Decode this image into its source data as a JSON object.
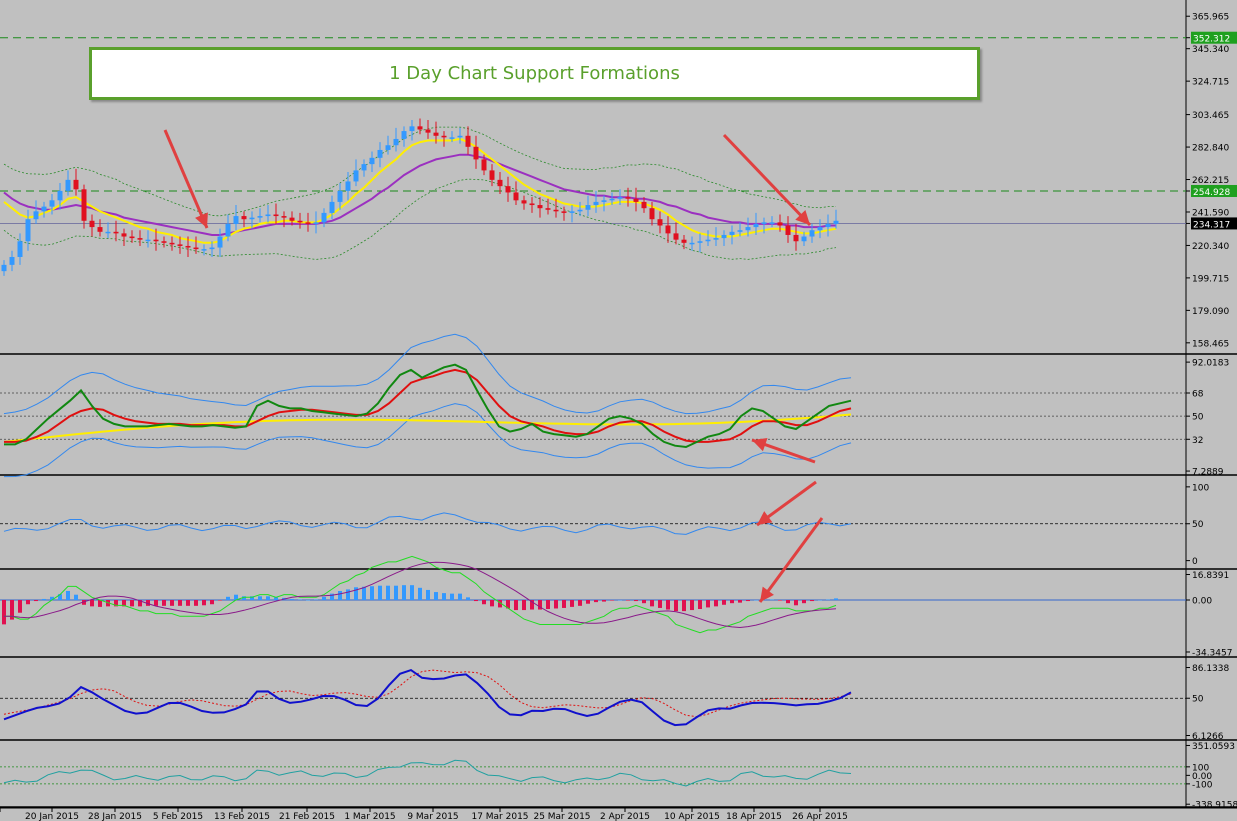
{
  "chart_data": {
    "title": "1 Day Chart Support Formations",
    "type": "candlestick",
    "x_ticks": [
      "2015",
      "20 Jan 2015",
      "28 Jan 2015",
      "5 Feb 2015",
      "13 Feb 2015",
      "21 Feb 2015",
      "1 Mar 2015",
      "9 Mar 2015",
      "17 Mar 2015",
      "25 Mar 2015",
      "2 Apr 2015",
      "10 Apr 2015",
      "18 Apr 2015",
      "26 Apr 2015"
    ],
    "price_panel": {
      "yticks": [
        365.965,
        345.34,
        324.715,
        303.465,
        282.84,
        262.215,
        241.59,
        220.34,
        199.715,
        179.09,
        158.465
      ],
      "ylim": [
        158.465,
        375.0
      ],
      "current_price": 234.317,
      "hlines": [
        {
          "value": 352.312,
          "label": "352.312",
          "color": "#1a8a1a"
        },
        {
          "value": 254.928,
          "label": "254.928",
          "color": "#1a8a1a"
        }
      ],
      "close": [
        208,
        213,
        223,
        237,
        242,
        245,
        249,
        255,
        262,
        256,
        236,
        232,
        229,
        229,
        228,
        226,
        225,
        224,
        224,
        223,
        222,
        221,
        220,
        219,
        218,
        218,
        219,
        226,
        234,
        239,
        237,
        238,
        239,
        240,
        239,
        238,
        236,
        235,
        234,
        235,
        241,
        248,
        255,
        261,
        268,
        272,
        276,
        281,
        284,
        288,
        293,
        296,
        294,
        292,
        290,
        289,
        289,
        290,
        283,
        275,
        268,
        262,
        258,
        254,
        249,
        247,
        246,
        244,
        243,
        242,
        241,
        242,
        243,
        246,
        248,
        249,
        250,
        251,
        250,
        248,
        244,
        237,
        233,
        228,
        224,
        222,
        222,
        223,
        224,
        225,
        227,
        229,
        230,
        232,
        234,
        235,
        235,
        233,
        227,
        223,
        226,
        230,
        232,
        234,
        236
      ],
      "ema_fast": [
        248,
        244,
        240,
        238,
        239,
        241,
        243,
        246,
        250,
        251,
        248,
        245,
        242,
        240,
        238,
        236,
        234,
        232,
        231,
        229,
        228,
        227,
        225,
        224,
        223,
        222,
        222,
        223,
        226,
        229,
        231,
        232,
        234,
        235,
        235,
        236,
        236,
        235,
        235,
        235,
        237,
        240,
        244,
        248,
        253,
        257,
        262,
        267,
        271,
        275,
        280,
        284,
        286,
        287,
        287,
        287,
        287,
        288,
        286,
        283,
        279,
        275,
        271,
        267,
        263,
        259,
        256,
        253,
        251,
        249,
        247,
        246,
        245,
        245,
        245,
        246,
        247,
        248,
        248,
        248,
        247,
        245,
        243,
        240,
        236,
        233,
        230,
        228,
        227,
        226,
        226,
        226,
        227,
        228,
        229,
        230,
        231,
        231,
        230,
        229,
        228,
        228,
        229,
        230,
        231
      ],
      "ema_slow": [
        254,
        250,
        247,
        245,
        244,
        243,
        243,
        244,
        245,
        246,
        245,
        244,
        242,
        241,
        240,
        238,
        237,
        236,
        235,
        234,
        233,
        232,
        231,
        230,
        229,
        228,
        227,
        227,
        228,
        229,
        230,
        231,
        232,
        233,
        234,
        234,
        234,
        234,
        234,
        234,
        235,
        236,
        238,
        241,
        244,
        247,
        250,
        254,
        257,
        261,
        265,
        268,
        271,
        273,
        275,
        276,
        277,
        278,
        278,
        277,
        276,
        274,
        272,
        270,
        268,
        266,
        264,
        262,
        260,
        258,
        256,
        255,
        254,
        253,
        252,
        252,
        251,
        251,
        251,
        250,
        250,
        249,
        248,
        246,
        245,
        243,
        241,
        240,
        238,
        237,
        236,
        235,
        235,
        234,
        234,
        234,
        234,
        234,
        233,
        233,
        232,
        232,
        232,
        233,
        233
      ]
    },
    "rsi_panel": {
      "yticks": [
        92.0183,
        68,
        50,
        32,
        7.2889
      ],
      "ylim": [
        7.2889,
        92.0183
      ],
      "rsi": [
        28,
        28,
        32,
        40,
        48,
        55,
        62,
        70,
        58,
        48,
        44,
        42,
        42,
        42,
        43,
        44,
        43,
        42,
        42,
        43,
        42,
        41,
        42,
        58,
        62,
        58,
        56,
        56,
        54,
        53,
        52,
        51,
        50,
        52,
        60,
        72,
        82,
        86,
        80,
        84,
        88,
        90,
        86,
        70,
        55,
        42,
        38,
        40,
        44,
        38,
        36,
        35,
        34,
        36,
        42,
        48,
        50,
        48,
        44,
        36,
        30,
        27,
        26,
        30,
        34,
        36,
        40,
        50,
        56,
        54,
        48,
        42,
        40,
        46,
        52,
        58,
        60,
        62
      ],
      "signal": [
        30,
        30,
        31,
        34,
        38,
        44,
        50,
        54,
        56,
        55,
        51,
        48,
        46,
        45,
        44,
        44,
        44,
        43,
        43,
        43,
        43,
        42,
        42,
        46,
        50,
        53,
        54,
        55,
        55,
        54,
        53,
        52,
        51,
        51,
        54,
        60,
        68,
        76,
        79,
        81,
        84,
        86,
        84,
        78,
        68,
        58,
        50,
        46,
        44,
        42,
        39,
        37,
        36,
        36,
        38,
        42,
        45,
        46,
        46,
        43,
        38,
        34,
        31,
        30,
        30,
        31,
        32,
        36,
        42,
        46,
        46,
        45,
        43,
        43,
        46,
        50,
        54,
        56
      ]
    },
    "oscillator_panel": {
      "yticks": [
        100,
        50,
        0
      ],
      "ylim": [
        0,
        100
      ]
    },
    "macd_panel": {
      "yticks": [
        16.8391,
        0.0,
        -34.3457
      ],
      "ylim": [
        -34.3457,
        16.8391
      ]
    },
    "stoch_panel": {
      "yticks": [
        86.1338,
        50,
        6.1266
      ],
      "ylim": [
        6.1266,
        86.1338
      ]
    },
    "cci_panel": {
      "yticks": [
        351.0593,
        100,
        0.0,
        -100,
        -338.9158
      ],
      "ylim": [
        -338.9158,
        351.0593
      ]
    }
  }
}
